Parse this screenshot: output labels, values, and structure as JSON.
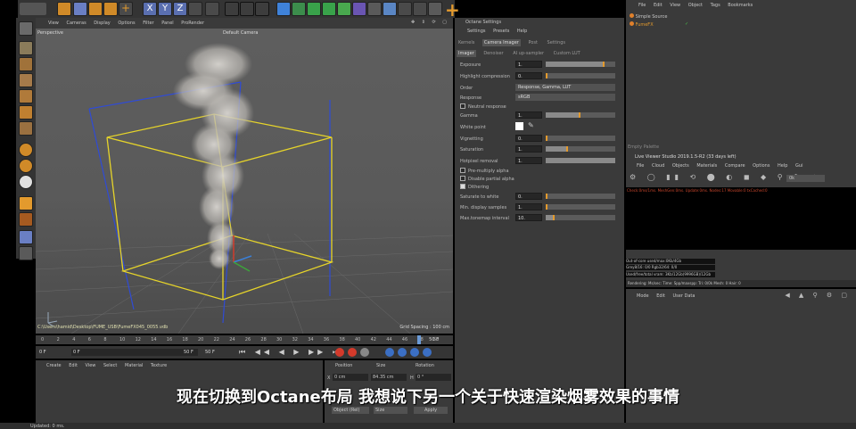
{
  "viewport": {
    "menu": [
      "View",
      "Cameras",
      "Display",
      "Options",
      "Filter",
      "Panel",
      "ProRender"
    ],
    "label": "Perspective",
    "camera": "Default Camera",
    "grid_spacing": "Grid Spacing : 100 cm",
    "path": "C:\\Users\\hamid\\Desktop\\FUME_USB\\FumeFX045_0055.vdb"
  },
  "timeline": {
    "ticks": [
      "0",
      "2",
      "4",
      "6",
      "8",
      "10",
      "12",
      "14",
      "16",
      "18",
      "20",
      "22",
      "24",
      "26",
      "28",
      "30",
      "32",
      "34",
      "36",
      "38",
      "40",
      "42",
      "44",
      "46",
      "48",
      "50"
    ],
    "end_label": "50 F",
    "field_start": "0 F",
    "field_cur": "0 F",
    "field_end": "50 F",
    "field_end2": "50 F"
  },
  "material_bar": {
    "menu": [
      "Create",
      "Edit",
      "View",
      "Select",
      "Material",
      "Texture"
    ]
  },
  "coordinates": {
    "headers": [
      "Position",
      "Size",
      "Rotation"
    ],
    "axis_x": "X",
    "x_pos": "0 cm",
    "x_size": "84.35 cm",
    "h_label": "H",
    "h_val": "0 °",
    "object_mode": "Object (Rel)",
    "size_mode": "Size",
    "apply": "Apply"
  },
  "octane": {
    "title": "Octane Settings",
    "menu": [
      "Settings",
      "Presets",
      "Help"
    ],
    "tabs": [
      "Kernels",
      "Camera Imager",
      "Post",
      "Settings"
    ],
    "subtabs": [
      "Imager",
      "Denoiser",
      "AI up-sampler",
      "Custom LUT"
    ],
    "exposure": {
      "label": "Exposure",
      "value": "1.",
      "level": 0.82
    },
    "highlight": {
      "label": "Highlight compression",
      "value": "0."
    },
    "order": {
      "label": "Order",
      "value": "Response, Gamma, LUT"
    },
    "response": {
      "label": "Response",
      "value": "sRGB"
    },
    "neutral": {
      "label": "Neutral response"
    },
    "gamma": {
      "label": "Gamma",
      "value": "1.",
      "level": 0.48
    },
    "white_point": {
      "label": "White point"
    },
    "vignetting": {
      "label": "Vignetting",
      "value": "0."
    },
    "saturation": {
      "label": "Saturation",
      "value": "1.",
      "level": 0.3
    },
    "hotpixel": {
      "label": "Hotpixel removal",
      "value": "1."
    },
    "premultiply": {
      "label": "Pre-multiply alpha"
    },
    "disable_partial": {
      "label": "Disable partial alpha"
    },
    "dithering": {
      "label": "Dithering"
    },
    "sat_white": {
      "label": "Saturate to white",
      "value": "0."
    },
    "min_samples": {
      "label": "Min. display samples",
      "value": "1."
    },
    "max_tonemap": {
      "label": "Max.tonemap interval",
      "value": "10.",
      "level": 0.1
    }
  },
  "object_manager": {
    "menu": [
      "File",
      "Edit",
      "View",
      "Object",
      "Tags",
      "Bookmarks"
    ],
    "items": [
      "Simple Source",
      "FumeFX"
    ]
  },
  "live_viewer": {
    "title": "Live Viewer Studio 2019.1.5-R2 (33 days left)",
    "menu": [
      "File",
      "Cloud",
      "Objects",
      "Materials",
      "Compare",
      "Options",
      "Help",
      "Gui"
    ],
    "zoom": "0k",
    "status_top": "Check:0ms/1ms. MeshGen:0ms. Update:0ms. Nodes:17 Movable:0 txCached:0",
    "stat1": "Out-of-core used/max:0Kb/4Gb",
    "stat2": "Grey8/16: 0/0      Rgb32/64: 0/0",
    "stat3": "Used/free/total vram: 3Kb/12Gb(9996GB)/12Gb",
    "status_row": "Rendering:   Ms/sec:   Time:   Spp/maxspp:   Tri: 0/0k   Mesh: 0   Hair: 0",
    "panel_label": "Empty Palette"
  },
  "attributes": {
    "menu": [
      "Mode",
      "Edit",
      "User Data"
    ]
  },
  "status_bar": "Updated: 0 ms.",
  "subtitle": "现在切换到Octane布局 我想说下另一个关于快速渲染烟雾效果的事情"
}
